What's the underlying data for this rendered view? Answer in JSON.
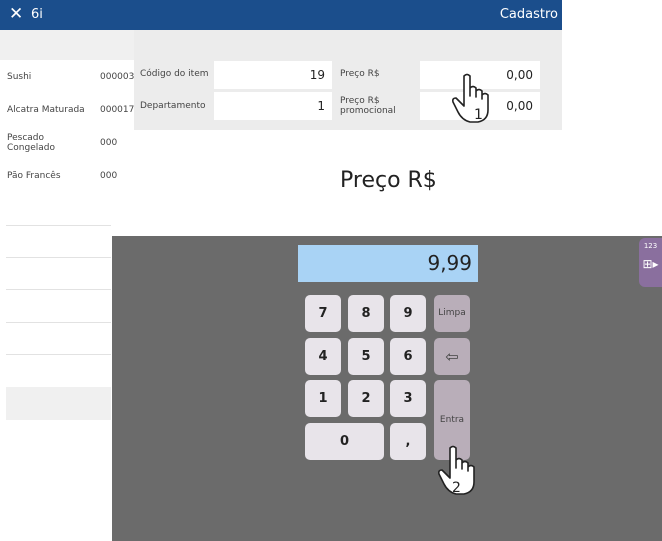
{
  "titlebar": {
    "close": "✕",
    "title": "6i",
    "right": "Cadastro"
  },
  "left_list": [
    {
      "name": "Sushi",
      "code": "000003"
    },
    {
      "name": "Alcatra Maturada",
      "code": "000017"
    },
    {
      "name": "Pescado Congelado",
      "code": "000"
    },
    {
      "name": "Pão Francês",
      "code": "000"
    }
  ],
  "form": {
    "codigo_label": "Código do item",
    "codigo_value": "19",
    "depto_label": "Departamento",
    "depto_value": "1",
    "preco_label": "Preço R$",
    "preco_value": "0,00",
    "promo_label": "Preço R$ promocional",
    "promo_value": "0,00"
  },
  "big_label": "Preço R$",
  "display_value": "9,99",
  "keys": {
    "k7": "7",
    "k8": "8",
    "k9": "9",
    "clear": "Limpa",
    "k4": "4",
    "k5": "5",
    "k6": "6",
    "backspace": "⇦",
    "k1": "1",
    "k2": "2",
    "k3": "3",
    "enter": "Entra",
    "k0": "0",
    "comma": ","
  },
  "side_tab": {
    "label": "123",
    "icon": "⊞▸"
  },
  "annotations": {
    "step1": "1",
    "step2": "2"
  },
  "colors": {
    "titlebar": "#1b4e8c",
    "keypad_bg": "#6b6b6b",
    "display_bg": "#a9d3f5",
    "key": "#e8e4ea",
    "key_fn": "#b9aeb9"
  }
}
